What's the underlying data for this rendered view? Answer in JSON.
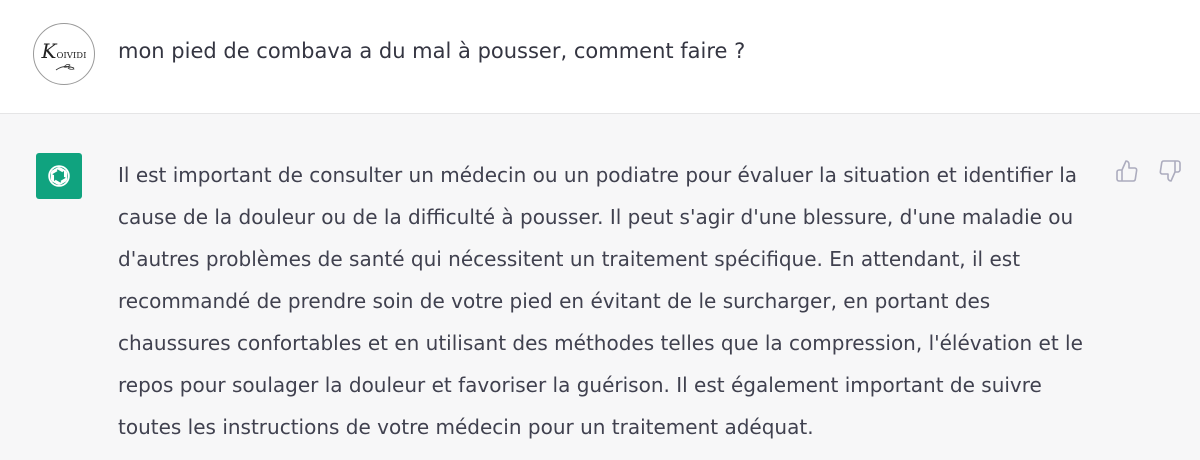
{
  "user_message": {
    "text": "mon pied de combava a du mal à pousser, comment faire ?",
    "avatar_logo_text": "KoIVIDI"
  },
  "assistant_message": {
    "text": "Il est important de consulter un médecin ou un podiatre pour évaluer la situation et identifier la cause de la douleur ou de la difficulté à pousser. Il peut s'agir d'une blessure, d'une maladie ou d'autres problèmes de santé qui nécessitent un traitement spécifique. En attendant, il est recommandé de prendre soin de votre pied en évitant de le surcharger, en portant des chaussures confortables et en utilisant des méthodes telles que la compression, l'élévation et le repos pour soulager la douleur et favoriser la guérison. Il est également important de suivre toutes les instructions de votre médecin pour un traitement adéquat."
  },
  "icons": {
    "user_avatar": "koividi-logo",
    "assistant_avatar": "openai-logo-icon",
    "feedback_up": "thumbs-up-icon",
    "feedback_down": "thumbs-down-icon"
  },
  "colors": {
    "assistant_avatar_bg": "#10a37f",
    "assistant_row_bg": "#f7f7f8",
    "text": "#343541",
    "icon": "#acacbe"
  }
}
